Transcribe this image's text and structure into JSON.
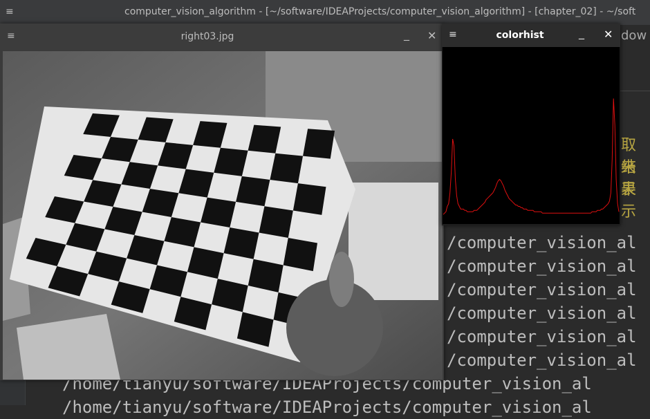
{
  "ide": {
    "title": "computer_vision_algorithm - [~/software/IDEAProjects/computer_vision_algorithm] - [chapter_02] - ~/soft",
    "right_peek_text": "dow",
    "cjk_line1": "取结果",
    "cjk_line2": "来表示"
  },
  "console": {
    "lines": [
      "/computer_vision_al",
      "/computer_vision_al",
      "/computer_vision_al",
      "/computer_vision_al",
      "/computer_vision_al",
      "/computer_vision_al",
      "/home/tianyu/software/IDEAProjects/computer_vision_al",
      "/home/tianyu/software/IDEAProjects/computer_vision_al"
    ]
  },
  "image_window": {
    "title": "right03.jpg",
    "image_description": "grayscale photo of a person holding a checkerboard calibration pattern",
    "menu_icon": "hamburger-icon",
    "minimize_icon": "minimize-icon",
    "close_icon": "close-icon"
  },
  "hist_window": {
    "title": "colorhist",
    "menu_icon": "hamburger-icon",
    "line_color": "#e01010",
    "background_color": "#000000"
  },
  "chart_data": {
    "type": "line",
    "title": "",
    "xlabel": "",
    "ylabel": "",
    "xlim": [
      0,
      255
    ],
    "series": [
      {
        "values": [
          0.04,
          0.05,
          0.06,
          0.1,
          0.12,
          0.2,
          0.35,
          0.6,
          0.55,
          0.3,
          0.18,
          0.12,
          0.1,
          0.08,
          0.08,
          0.08,
          0.07,
          0.07,
          0.06,
          0.06,
          0.06,
          0.06,
          0.06,
          0.07,
          0.07,
          0.07,
          0.08,
          0.09,
          0.1,
          0.11,
          0.12,
          0.13,
          0.15,
          0.16,
          0.17,
          0.18,
          0.19,
          0.2,
          0.22,
          0.24,
          0.27,
          0.29,
          0.3,
          0.29,
          0.27,
          0.25,
          0.22,
          0.2,
          0.18,
          0.16,
          0.15,
          0.14,
          0.13,
          0.12,
          0.11,
          0.11,
          0.1,
          0.1,
          0.09,
          0.09,
          0.08,
          0.08,
          0.08,
          0.07,
          0.07,
          0.07,
          0.07,
          0.07,
          0.06,
          0.06,
          0.06,
          0.06,
          0.06,
          0.06,
          0.05,
          0.05,
          0.05,
          0.05,
          0.05,
          0.05,
          0.05,
          0.05,
          0.05,
          0.05,
          0.05,
          0.05,
          0.05,
          0.05,
          0.05,
          0.05,
          0.05,
          0.05,
          0.05,
          0.05,
          0.05,
          0.05,
          0.05,
          0.05,
          0.05,
          0.05,
          0.05,
          0.05,
          0.05,
          0.05,
          0.05,
          0.05,
          0.05,
          0.05,
          0.05,
          0.05,
          0.05,
          0.06,
          0.06,
          0.06,
          0.06,
          0.07,
          0.07,
          0.07,
          0.08,
          0.08,
          0.09,
          0.1,
          0.11,
          0.12,
          0.14,
          0.2,
          0.45,
          0.9,
          0.7,
          0.3,
          0.12,
          0.06
        ]
      }
    ]
  }
}
